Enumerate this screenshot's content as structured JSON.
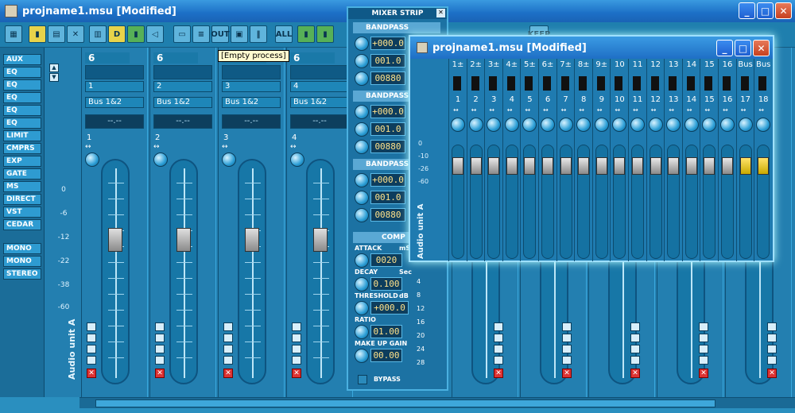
{
  "window": {
    "title": "projname1.msu [Modified]"
  },
  "toolbar": {
    "d_label": "D",
    "out_label": "OUT",
    "all_label": "ALL",
    "keep_label": "KEEP"
  },
  "left_panel": {
    "buttons": [
      "AUX",
      "EQ",
      "EQ",
      "EQ",
      "EQ",
      "EQ",
      "LIMIT",
      "CMPRS",
      "EXP",
      "GATE",
      "MS",
      "DIRECT",
      "VST",
      "CEDAR",
      "MONO",
      "MONO",
      "STEREO"
    ]
  },
  "meter_scale": [
    "0",
    "-6",
    "-12",
    "-22",
    "-38",
    "-60"
  ],
  "tooltip": "[Empty process]",
  "unit_label": "Audio unit A",
  "strips": [
    {
      "tag": "6",
      "num": "1",
      "bus": "Bus 1&2",
      "display": "--.--",
      "ch": "1",
      "fader": 0.3
    },
    {
      "tag": "6",
      "num": "2",
      "bus": "Bus 1&2",
      "display": "--.--",
      "ch": "2",
      "fader": 0.3
    },
    {
      "tag": "6",
      "num": "3",
      "bus": "Bus 1&2",
      "display": "--.--",
      "ch": "3",
      "fader": 0.3
    },
    {
      "tag": "6",
      "num": "4",
      "bus": "Bus 1&2",
      "display": "--.--",
      "ch": "4",
      "fader": 0.3
    }
  ],
  "mixer": {
    "title": "MIXER STRIP",
    "bandpass_label": "BANDPASS",
    "bands": [
      {
        "gain": "+000.0",
        "q": "001.0",
        "freq": "00880"
      },
      {
        "gain": "+000.0",
        "q": "001.0",
        "freq": "00880"
      },
      {
        "gain": "+000.0",
        "q": "001.0",
        "freq": "00880"
      }
    ],
    "comp": {
      "title": "COMP",
      "attack_label": "ATTACK",
      "attack_unit": "mS",
      "attack": "0020",
      "decay_label": "DECAY",
      "decay_unit": "Sec",
      "decay": "0.100",
      "threshold_label": "THRESHOLD",
      "threshold_unit": "dB",
      "threshold": "+000.0",
      "ratio_label": "RATIO",
      "ratio": "01.00",
      "makeup_label": "MAKE UP GAIN",
      "makeup": "00.00"
    },
    "gr_scale": [
      "4",
      "8",
      "12",
      "16",
      "20",
      "24",
      "28"
    ],
    "bypass_label": "BYPASS"
  },
  "float_window": {
    "title": "projname1.msu [Modified]",
    "unit_label": "Audio unit A",
    "scale": [
      "0",
      "-10",
      "-26",
      "-60"
    ],
    "channels": [
      {
        "top": "1±",
        "num": "1",
        "fader": 0.2,
        "yellow": false
      },
      {
        "top": "2±",
        "num": "2",
        "fader": 0.2,
        "yellow": false
      },
      {
        "top": "3±",
        "num": "3",
        "fader": 0.2,
        "yellow": false
      },
      {
        "top": "4±",
        "num": "4",
        "fader": 0.2,
        "yellow": false
      },
      {
        "top": "5±",
        "num": "5",
        "fader": 0.2,
        "yellow": false
      },
      {
        "top": "6±",
        "num": "6",
        "fader": 0.2,
        "yellow": false
      },
      {
        "top": "7±",
        "num": "7",
        "fader": 0.2,
        "yellow": false
      },
      {
        "top": "8±",
        "num": "8",
        "fader": 0.2,
        "yellow": false
      },
      {
        "top": "9±",
        "num": "9",
        "fader": 0.2,
        "yellow": false
      },
      {
        "top": "10",
        "num": "10",
        "fader": 0.2,
        "yellow": false
      },
      {
        "top": "11",
        "num": "11",
        "fader": 0.2,
        "yellow": false
      },
      {
        "top": "12",
        "num": "12",
        "fader": 0.2,
        "yellow": false
      },
      {
        "top": "13",
        "num": "13",
        "fader": 0.2,
        "yellow": false
      },
      {
        "top": "14",
        "num": "14",
        "fader": 0.2,
        "yellow": false
      },
      {
        "top": "15",
        "num": "15",
        "fader": 0.2,
        "yellow": false
      },
      {
        "top": "16",
        "num": "16",
        "fader": 0.2,
        "yellow": false
      },
      {
        "top": "Bus",
        "num": "17",
        "fader": 0.2,
        "yellow": true
      },
      {
        "top": "Bus",
        "num": "18",
        "fader": 0.2,
        "yellow": true
      }
    ]
  }
}
